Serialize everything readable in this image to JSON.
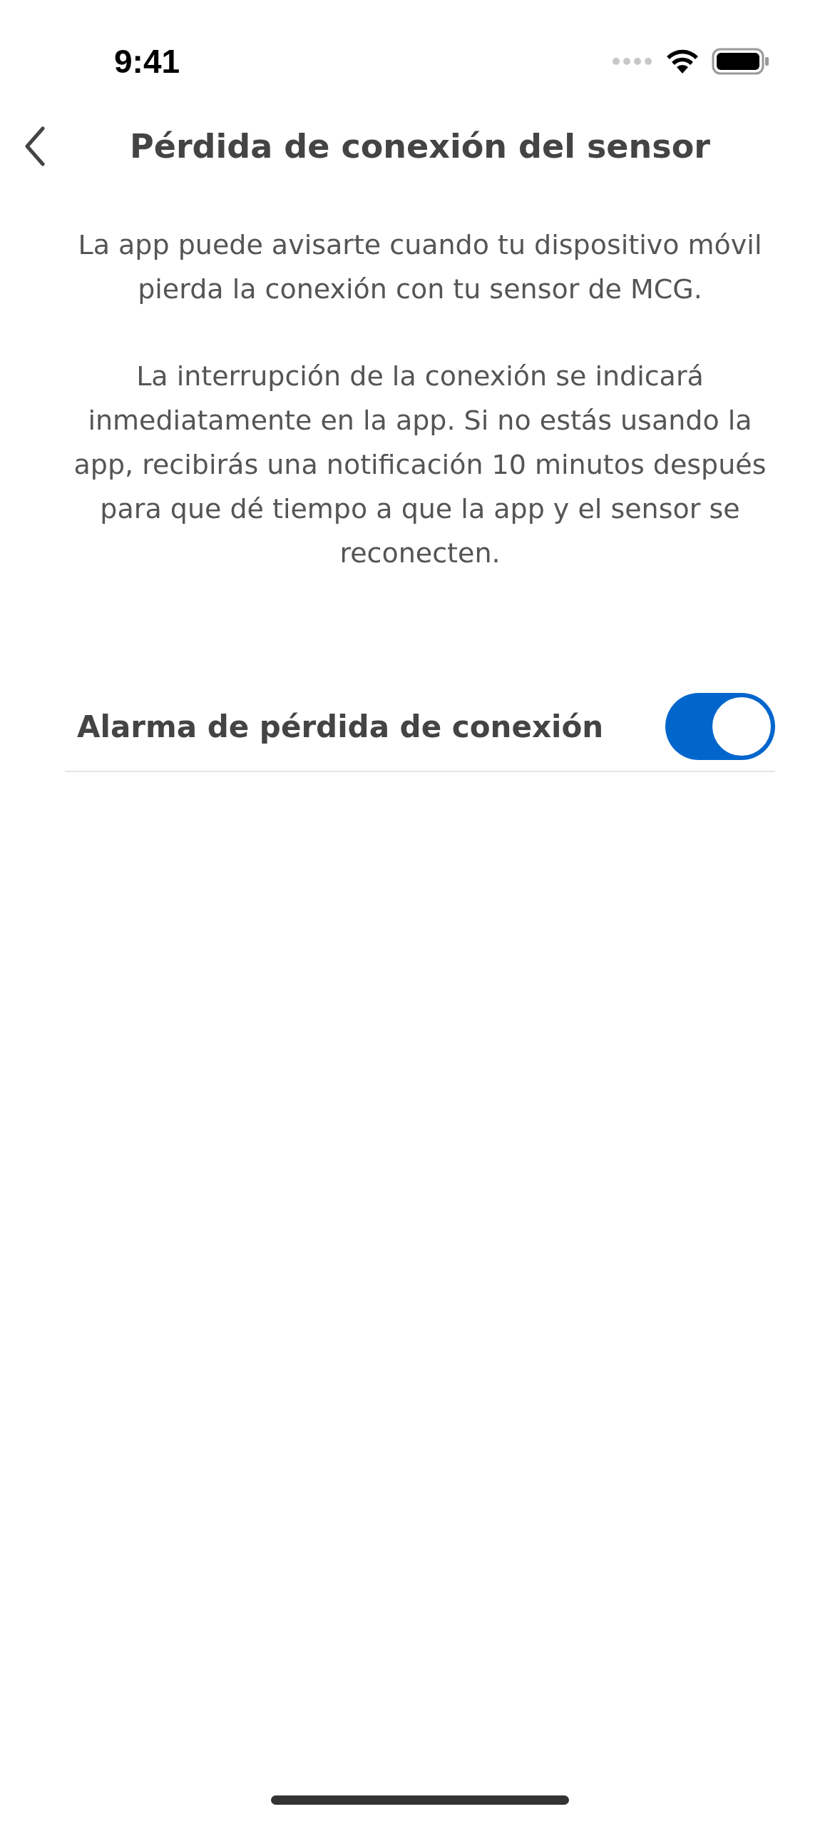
{
  "status_bar": {
    "time": "9:41"
  },
  "header": {
    "title": "Pérdida de conexión del sensor"
  },
  "paragraphs": [
    "La app puede avisarte cuando tu dispositivo móvil pierda la conexión con tu sensor de MCG.",
    "La interrupción de la conexión se indicará inmediatamente en la app. Si no estás usando la app, recibirás una notificación 10 minutos después para que dé tiempo a que la app y el sensor se reconecten."
  ],
  "settings": [
    {
      "label": "Alarma de pérdida de conexión",
      "on": true
    }
  ]
}
